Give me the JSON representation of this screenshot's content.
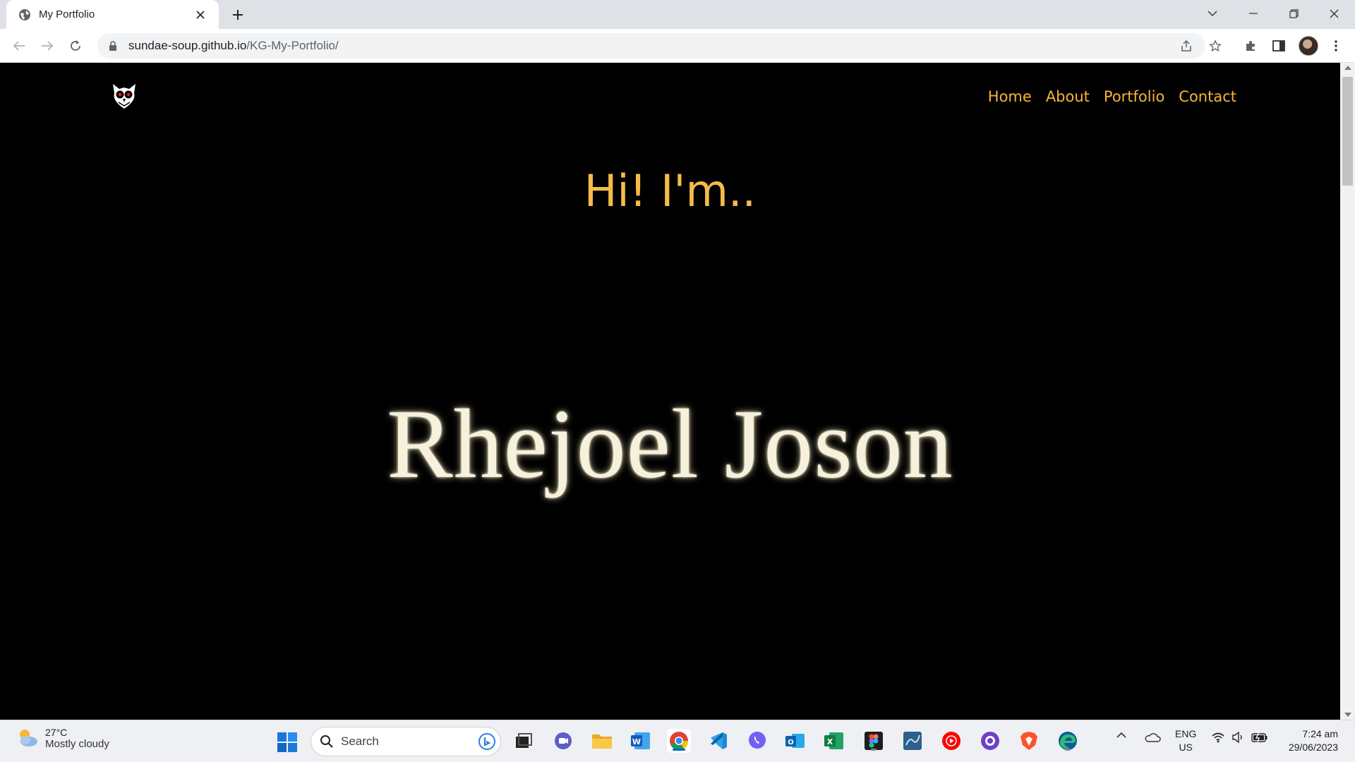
{
  "browser": {
    "tab_title": "My Portfolio",
    "url_host": "sundae-soup.github.io",
    "url_path": "/KG-My-Portfolio/"
  },
  "site": {
    "nav": [
      "Home",
      "About",
      "Portfolio",
      "Contact"
    ],
    "greeting": "Hi! I'm..",
    "name": "Rhejoel Joson",
    "accent_color": "#f5b53b",
    "name_color": "#f6f1dd",
    "logo_icon": "owl-logo-icon"
  },
  "taskbar": {
    "weather_temp": "27°C",
    "weather_condition": "Mostly cloudy",
    "search_placeholder": "Search",
    "lang_line1": "ENG",
    "lang_line2": "US",
    "time": "7:24 am",
    "date": "29/06/2023",
    "apps": [
      "file-explorer-task-view",
      "teams-chat",
      "file-explorer",
      "word",
      "chrome",
      "vscode",
      "viber",
      "outlook",
      "excel",
      "figma",
      "sql-tool",
      "youtube-music",
      "github-desktop",
      "brave",
      "edge"
    ]
  }
}
